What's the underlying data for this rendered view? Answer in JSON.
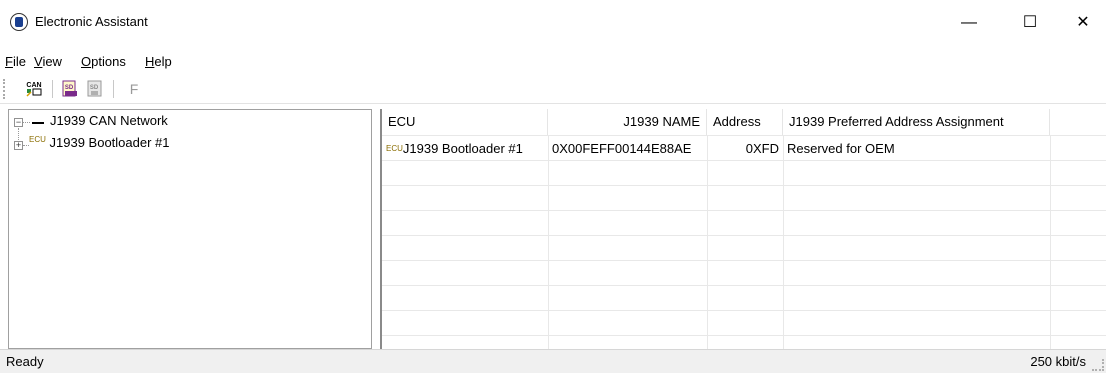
{
  "window": {
    "title": "Electronic Assistant",
    "minimize": "—",
    "maximize": "☐",
    "close": "✕"
  },
  "menu": [
    {
      "accel": "F",
      "rest": "ile"
    },
    {
      "accel": "V",
      "rest": "iew"
    },
    {
      "accel": "O",
      "rest": "ptions"
    },
    {
      "accel": "H",
      "rest": "elp"
    }
  ],
  "toolbar": {
    "can_icon_text": "CAN",
    "sd1_icon_text": "SD",
    "sd2_icon_text": "SD",
    "f_label": "F"
  },
  "tree": {
    "root": {
      "expander": "−",
      "label": "J1939 CAN Network"
    },
    "child": {
      "expander": "+",
      "tag": "ECU",
      "label": "J1939 Bootloader #1"
    }
  },
  "table": {
    "columns": [
      "ECU",
      "J1939 NAME",
      "Address",
      "J1939 Preferred Address Assignment"
    ],
    "rows": [
      {
        "tag": "ECU",
        "ecu": "J1939 Bootloader #1",
        "name": "0X00FEFF00144E88AE",
        "address": "0XFD",
        "assignment": "Reserved for OEM"
      }
    ]
  },
  "status": {
    "text": "Ready",
    "rate": "250 kbit/s"
  },
  "colors": {
    "tag": "#8a6d00",
    "sd_icon": "#7a2a8a",
    "can_icon": "#2a8a3a"
  }
}
